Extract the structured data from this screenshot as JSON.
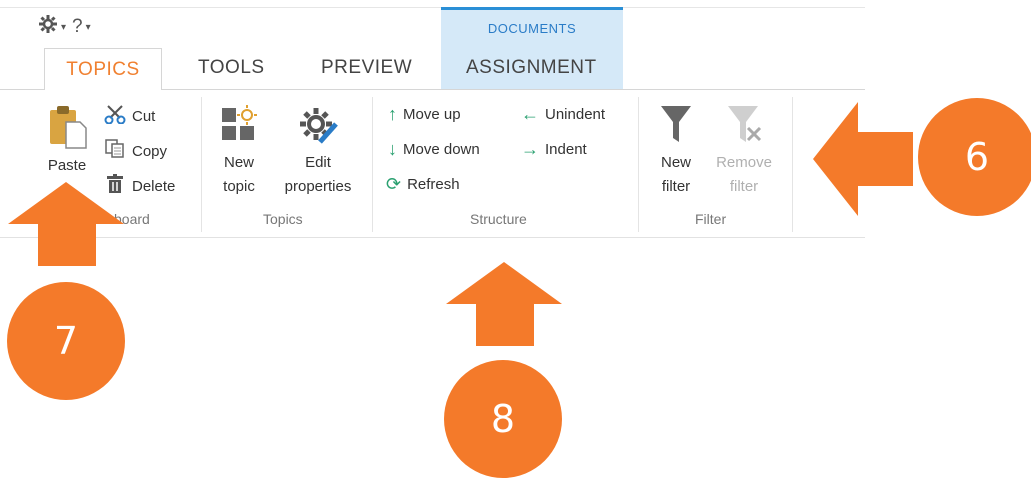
{
  "quick_access": {
    "help_label": "?"
  },
  "contextual_group": {
    "label": "DOCUMENTS"
  },
  "tabs": [
    {
      "label": "TOPICS",
      "active": true
    },
    {
      "label": "TOOLS"
    },
    {
      "label": "PREVIEW"
    },
    {
      "label": "ASSIGNMENT"
    }
  ],
  "clipboard": {
    "paste": "Paste",
    "cut": "Cut",
    "copy": "Copy",
    "delete": "Delete",
    "group_label_visible": "board"
  },
  "topics": {
    "new_line1": "New",
    "new_line2": "topic",
    "edit_line1": "Edit",
    "edit_line2": "properties",
    "group_label": "Topics"
  },
  "structure": {
    "move_up": "Move up",
    "move_down": "Move down",
    "refresh": "Refresh",
    "unindent": "Unindent",
    "indent": "Indent",
    "group_label": "Structure"
  },
  "filter": {
    "new_line1": "New",
    "new_line2": "filter",
    "remove_line1": "Remove",
    "remove_line2": "filter",
    "group_label": "Filter"
  },
  "callouts": {
    "c6": "6",
    "c7": "7",
    "c8": "8"
  },
  "colors": {
    "accent": "#f47a2a",
    "contextual": "#d5e9f8",
    "contextual_border": "#2a8fd6"
  }
}
